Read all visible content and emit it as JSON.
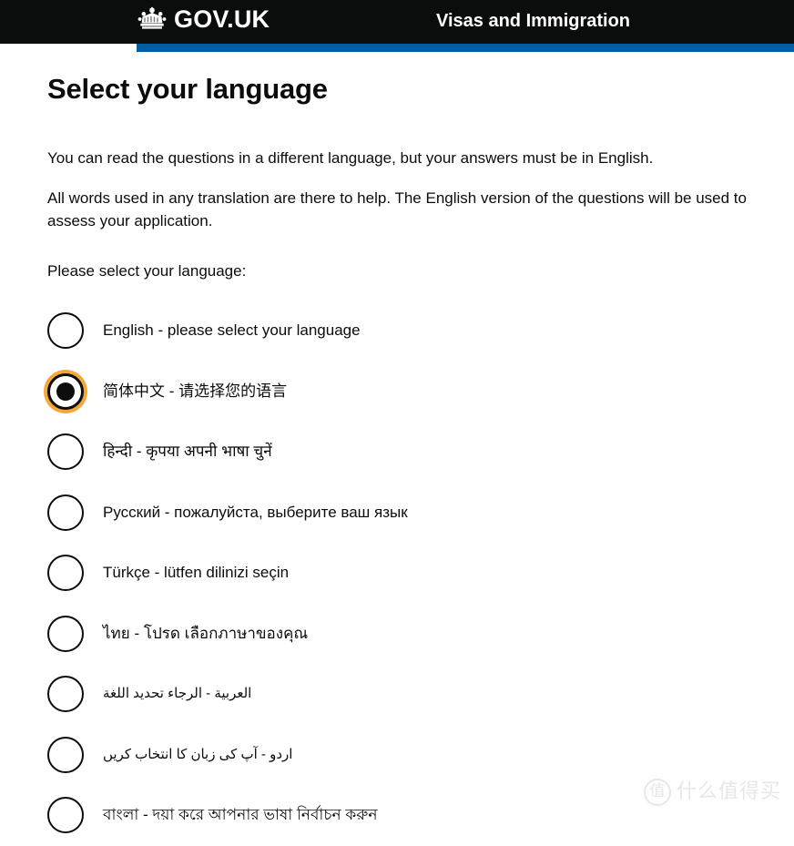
{
  "header": {
    "brand_name": "GOV.UK",
    "crown_icon": "crown-icon",
    "service_name": "Visas and Immigration",
    "background_color": "#0b0c0c",
    "accent_bar_color": "#005ea5"
  },
  "main": {
    "page_title": "Select your language",
    "paragraph_1": "You can read the questions in a different language, but your answers must be in English.",
    "paragraph_2": "All words used in any translation are there to help. The English version of the questions will be used to assess your application.",
    "prompt": "Please select your language:",
    "focus_ring_color": "#f4a83a",
    "options": [
      {
        "label": "English - please select your language",
        "selected": false,
        "dir": "ltr"
      },
      {
        "label": "简体中文 - 请选择您的语言",
        "selected": true,
        "dir": "ltr"
      },
      {
        "label": "हिन्दी - कृपया अपनी भाषा चुनें",
        "selected": false,
        "dir": "ltr"
      },
      {
        "label": "Русский - пожалуйста, выберите ваш язык",
        "selected": false,
        "dir": "ltr"
      },
      {
        "label": "Türkçe - lütfen dilinizi seçin",
        "selected": false,
        "dir": "ltr"
      },
      {
        "label": "ไทย - โปรด เลือกภาษาของคุณ",
        "selected": false,
        "dir": "ltr"
      },
      {
        "label": "العربية - الرجاء تحديد اللغة",
        "selected": false,
        "dir": "rtl"
      },
      {
        "label": "اردو - آپ کی زبان کا انتخاب کریں",
        "selected": false,
        "dir": "rtl"
      },
      {
        "label": "বাংলা - দয়া করে আপনার ভাষা নির্বাচন করুন",
        "selected": false,
        "dir": "ltr"
      }
    ]
  },
  "watermark": {
    "mark": "值",
    "text": "什么值得买"
  }
}
